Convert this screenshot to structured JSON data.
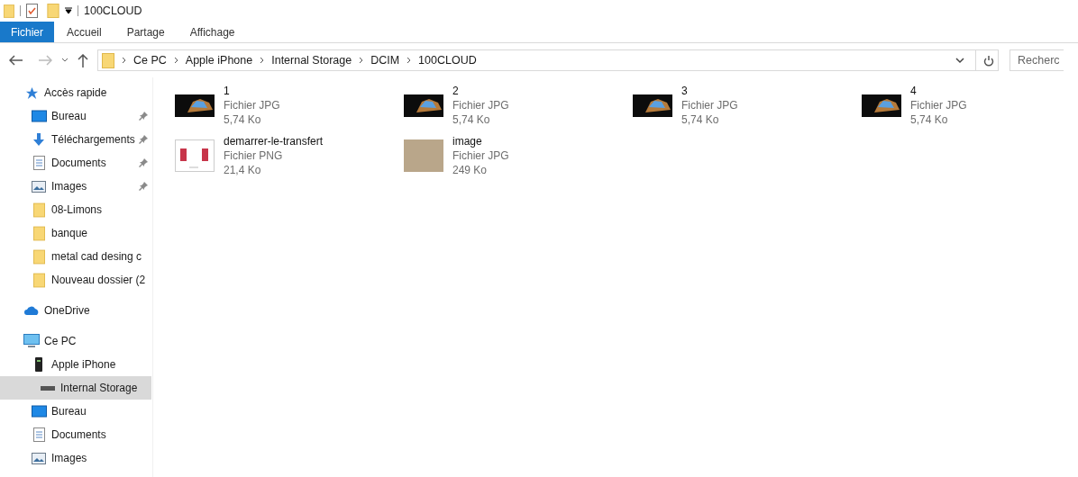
{
  "window": {
    "title": "100CLOUD"
  },
  "ribbon_tabs": [
    {
      "label": "Fichier",
      "selected": true
    },
    {
      "label": "Accueil",
      "selected": false
    },
    {
      "label": "Partage",
      "selected": false
    },
    {
      "label": "Affichage",
      "selected": false
    }
  ],
  "address_bar": {
    "path": [
      "Ce PC",
      "Apple iPhone",
      "Internal Storage",
      "DCIM",
      "100CLOUD"
    ]
  },
  "search": {
    "placeholder": "Recherc"
  },
  "sidebar": {
    "sections": [
      {
        "label": "Accès rapide",
        "kind": "star",
        "selected": false,
        "children": [
          {
            "label": "Bureau",
            "kind": "desktop",
            "pinned": true,
            "selected": false
          },
          {
            "label": "Téléchargements",
            "kind": "download",
            "pinned": true,
            "selected": false
          },
          {
            "label": "Documents",
            "kind": "document",
            "pinned": true,
            "selected": false
          },
          {
            "label": "Images",
            "kind": "pictures",
            "pinned": true,
            "selected": false
          },
          {
            "label": "08-Limons",
            "kind": "folder",
            "pinned": false,
            "selected": false
          },
          {
            "label": "banque",
            "kind": "folder",
            "pinned": false,
            "selected": false
          },
          {
            "label": "metal cad desing c",
            "kind": "folder",
            "pinned": false,
            "selected": false
          },
          {
            "label": "Nouveau dossier (2",
            "kind": "folder",
            "pinned": false,
            "selected": false
          }
        ]
      },
      {
        "label": "OneDrive",
        "kind": "cloud",
        "selected": false
      },
      {
        "label": "Ce PC",
        "kind": "computer",
        "selected": false,
        "children": [
          {
            "label": "Apple iPhone",
            "kind": "phone",
            "selected": false,
            "children": [
              {
                "label": "Internal Storage",
                "kind": "drive",
                "selected": true
              }
            ]
          },
          {
            "label": "Bureau",
            "kind": "desktop",
            "selected": false
          },
          {
            "label": "Documents",
            "kind": "document",
            "selected": false
          },
          {
            "label": "Images",
            "kind": "pictures",
            "selected": false
          }
        ]
      }
    ]
  },
  "files": [
    {
      "name": "1",
      "type": "Fichier JPG",
      "size": "5,74 Ko",
      "kind": "wallpaper"
    },
    {
      "name": "2",
      "type": "Fichier JPG",
      "size": "5,74 Ko",
      "kind": "wallpaper"
    },
    {
      "name": "3",
      "type": "Fichier JPG",
      "size": "5,74 Ko",
      "kind": "wallpaper"
    },
    {
      "name": "4",
      "type": "Fichier JPG",
      "size": "5,74 Ko",
      "kind": "wallpaper"
    },
    {
      "name": "demarrer-le-transfert",
      "type": "Fichier PNG",
      "size": "21,4 Ko",
      "kind": "screenshot"
    },
    {
      "name": "image",
      "type": "Fichier JPG",
      "size": "249 Ko",
      "kind": "photo"
    }
  ]
}
